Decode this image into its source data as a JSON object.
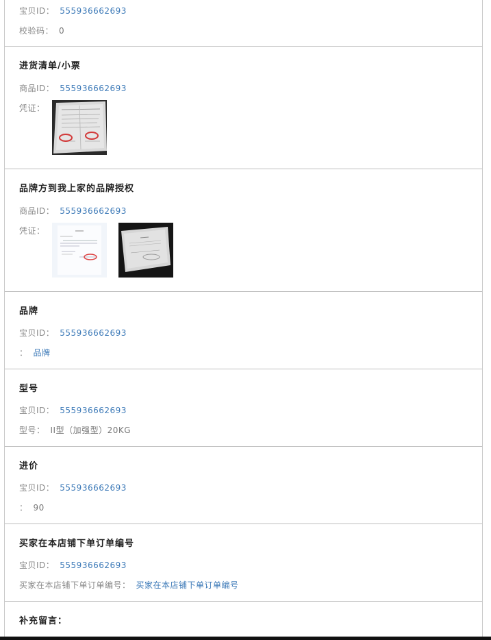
{
  "sections": {
    "top": {
      "rows": [
        {
          "label": "宝贝ID：",
          "value": "555936662693"
        },
        {
          "label": "校验码：",
          "value": "0"
        }
      ]
    },
    "invoice": {
      "title": "进货清单/小票",
      "rows": [
        {
          "label": "商品ID：",
          "value": "555936662693"
        },
        {
          "label": "凭证："
        }
      ]
    },
    "brand_auth": {
      "title": "品牌方到我上家的品牌授权",
      "rows": [
        {
          "label": "商品ID：",
          "value": "555936662693"
        },
        {
          "label": "凭证："
        }
      ]
    },
    "brand": {
      "title": "品牌",
      "rows": [
        {
          "label": "宝贝ID：",
          "value": "555936662693"
        },
        {
          "label": "：",
          "value": "品牌"
        }
      ]
    },
    "model": {
      "title": "型号",
      "rows": [
        {
          "label": "宝贝ID：",
          "value": "555936662693"
        },
        {
          "label": "型号：",
          "value": "II型（加强型）20KG"
        }
      ]
    },
    "price": {
      "title": "进价",
      "rows": [
        {
          "label": "宝贝ID：",
          "value": "555936662693"
        },
        {
          "label": "：",
          "value": "90"
        }
      ]
    },
    "order": {
      "title": "买家在本店铺下单订单编号",
      "rows": [
        {
          "label": "宝贝ID：",
          "value": "555936662693"
        },
        {
          "label": "买家在本店铺下单订单编号：",
          "value": "买家在本店铺下单订单编号"
        }
      ]
    },
    "notes": {
      "title": "补充留言："
    }
  }
}
